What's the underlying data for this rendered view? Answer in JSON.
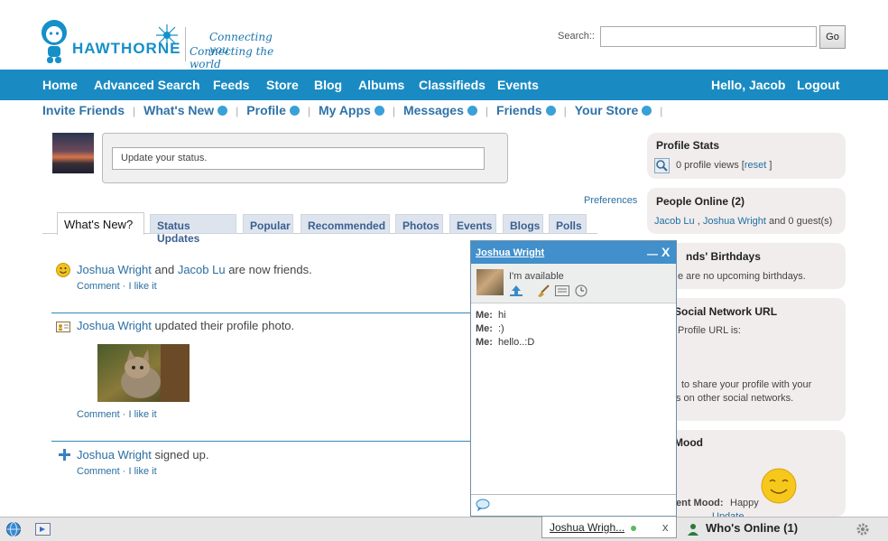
{
  "header": {
    "tagline_1": "Connecting you",
    "tagline_2": "Connecting the world",
    "brand": "HAWTHORNE",
    "search_label": "Search::",
    "go_label": "Go"
  },
  "nav": {
    "items": [
      "Home",
      "Advanced Search",
      "Feeds",
      "Store",
      "Blog",
      "Albums",
      "Classifieds",
      "Events"
    ],
    "greeting": "Hello, Jacob",
    "logout": "Logout"
  },
  "subnav": {
    "items": [
      "Invite Friends",
      "What's New",
      "Profile",
      "My Apps",
      "Messages",
      "Friends",
      "Your Store"
    ]
  },
  "status": {
    "placeholder": "Update your status."
  },
  "preferences": "Preferences",
  "tabs": [
    "What's New?",
    "Status Updates",
    "Popular",
    "Recommended",
    "Photos",
    "Events",
    "Blogs",
    "Polls"
  ],
  "feed": [
    {
      "user": "Joshua Wright",
      "mid": "and",
      "user2": "Jacob Lu",
      "tail": "are now friends.",
      "actions": "Comment · I like it"
    },
    {
      "user": "Joshua Wright",
      "tail": "updated their profile photo.",
      "actions": "Comment · I like it"
    },
    {
      "user": "Joshua Wright",
      "tail": "signed up.",
      "actions": "Comment · I like it"
    }
  ],
  "sidebar": {
    "profile_stats": {
      "title": "Profile Stats",
      "views": "0 profile views [",
      "reset": "reset",
      "close": "]"
    },
    "people_online": {
      "title": "People Online (2)",
      "user1": "Jacob Lu",
      "comma": ",",
      "user2": "Joshua Wright",
      "tail": "and 0 guest(s)"
    },
    "birthdays": {
      "title": "nds' Birthdays",
      "text": "e are no upcoming birthdays."
    },
    "social_url": {
      "title": "Social Network URL",
      "line1": "Profile URL is:",
      "line2": "to share your profile with your",
      "line3": "s on other social networks."
    },
    "mood": {
      "title": "Mood",
      "current": "ent Mood:",
      "value": "Happy",
      "update": "Update"
    }
  },
  "chat": {
    "name": "Joshua Wright",
    "minimize": "—",
    "close": "X",
    "status": "I'm available",
    "messages": [
      {
        "from": "Me:",
        "text": "hi"
      },
      {
        "from": "Me:",
        "text": ":)"
      },
      {
        "from": "Me:",
        "text": "hello..:D"
      }
    ]
  },
  "bottombar": {
    "chat_tab_name": "Joshua Wrigh...",
    "chat_tab_close": "x",
    "whos_online": "Who's Online (1)"
  },
  "colors": {
    "nav_bg": "#1a8bc2",
    "link": "#2b6ea0",
    "chat_header": "#418fcb",
    "panel_bg": "#f1eded"
  }
}
